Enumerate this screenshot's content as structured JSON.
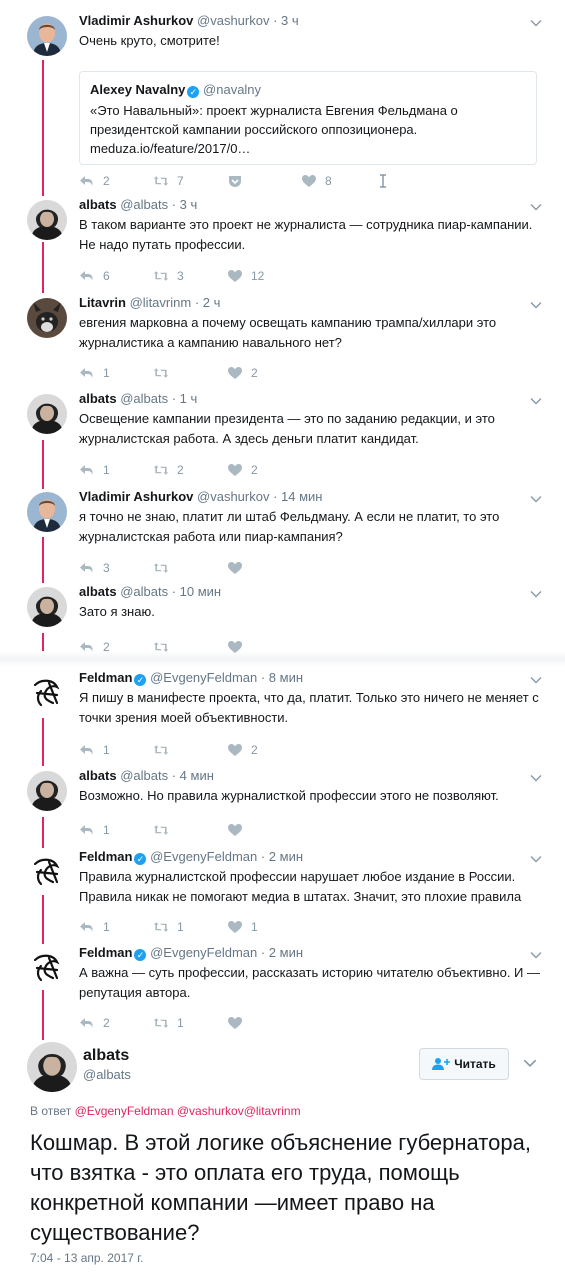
{
  "tweets": [
    {
      "name": "Vladimir Ashurkov",
      "handle": "@vashurkov",
      "time": "· 3 ч",
      "text": "Очень круто, смотрите!",
      "avatar": "person-suit",
      "quote": {
        "name": "Alexey Navalny",
        "handle": "@navalny",
        "text": "«Это Навальный»: проект журналиста Евгения Фельдмана о президентской кампании российского оппозиционера. meduza.io/feature/2017/0…"
      },
      "replies": "2",
      "retweets": "7",
      "likes": "8"
    },
    {
      "name": "albats",
      "handle": "@albats",
      "time": "· 3 ч",
      "text": "В таком варианте это проект не журналиста — сотрудника пиар-кампании. Не надо путать профессии.",
      "avatar": "person-dark",
      "replies": "6",
      "retweets": "3",
      "likes": "12"
    },
    {
      "name": "Litavrin",
      "handle": "@litavrinm",
      "time": "· 2 ч",
      "text": "евгения марковна а почему освещать кампанию трампа/хиллари это журналистика а кампанию навального нет?",
      "avatar": "dog",
      "replies": "1",
      "retweets": "",
      "likes": "2"
    },
    {
      "name": "albats",
      "handle": "@albats",
      "time": "· 1 ч",
      "text": "Освещение кампании президента — это по заданию редакции, и это журналистская работа. А здесь деньги платит кандидат.",
      "avatar": "person-dark",
      "replies": "1",
      "retweets": "2",
      "likes": "2"
    },
    {
      "name": "Vladimir Ashurkov",
      "handle": "@vashurkov",
      "time": "· 14 мин",
      "text": "я точно не знаю, платит ли штаб Фельдману. А если не платит, то это журналистская работа или пиар-кампания?",
      "avatar": "person-suit",
      "replies": "3",
      "retweets": "",
      "likes": ""
    },
    {
      "name": "albats",
      "handle": "@albats",
      "time": "· 10 мин",
      "text": "Зато я знаю.",
      "avatar": "person-dark",
      "replies": "2",
      "retweets": "",
      "likes": ""
    },
    {
      "name": "Feldman",
      "handle": "@EvgenyFeldman",
      "time": "· 8 мин",
      "text": "Я пишу в манифесте проекта, что да, платит. Только это ничего не меняет с точки зрения моей объективности.",
      "avatar": "sketch",
      "verified": true,
      "replies": "1",
      "retweets": "",
      "likes": "2"
    },
    {
      "name": "albats",
      "handle": "@albats",
      "time": "· 4 мин",
      "text": "Возможно. Но правила журналисткой профессии этого не позволяют.",
      "avatar": "person-dark",
      "replies": "1",
      "retweets": "",
      "likes": ""
    },
    {
      "name": "Feldman",
      "handle": "@EvgenyFeldman",
      "time": "· 2 мин",
      "text": "Правила журналистской профессии нарушает любое издание в России. Правила никак не помогают медиа в штатах. Значит, это плохие правила",
      "avatar": "sketch",
      "verified": true,
      "replies": "1",
      "retweets": "1",
      "likes": "1"
    },
    {
      "name": "Feldman",
      "handle": "@EvgenyFeldman",
      "time": "· 2 мин",
      "text": "А важна — суть профессии, рассказать историю читателю объективно. И — репутация автора.",
      "avatar": "sketch",
      "verified": true,
      "replies": "2",
      "retweets": "1",
      "likes": ""
    }
  ],
  "main": {
    "name": "albats",
    "handle": "@albats",
    "follow_label": "Читать",
    "reply_prefix": "В ответ",
    "reply_users": "@EvgenyFeldman @vashurkov@litavrinm",
    "text": "Кошмар. В этой логике объяснение губернатора, что взятка - это оплата его труда, помощь конкретной компании —имеет право на существование?",
    "timestamp": "7:04 - 13 апр. 2017 г."
  },
  "colors": {
    "thread": "#e0245e",
    "verified": "#1da1f2",
    "muted": "#657786",
    "icon": "#8899a6"
  }
}
